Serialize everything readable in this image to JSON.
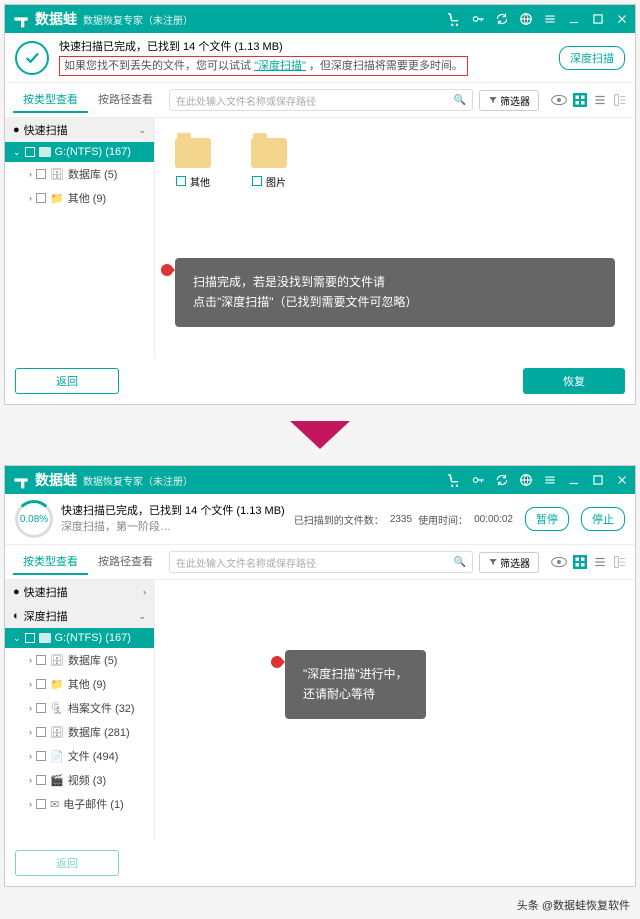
{
  "app": {
    "name": "数据蛙",
    "subtitle": "数据恢复专家（未注册）"
  },
  "win1": {
    "status_line1": "快速扫描已完成，已找到 14 个文件 (1.13 MB)",
    "hint_prefix": "如果您找不到丢失的文件，您可以试试",
    "hint_link": "\"深度扫描\"",
    "hint_suffix": "，但深度扫描将需要更多时间。",
    "deep_scan_btn": "深度扫描",
    "tabs": {
      "type": "按类型查看",
      "path": "按路径查看"
    },
    "search_placeholder": "在此处输入文件名称或保存路径",
    "filter_btn": "筛选器",
    "sidebar": {
      "quick": "快速扫描",
      "drive": "G:(NTFS) (167)",
      "children": [
        {
          "label": "数据库 (5)"
        },
        {
          "label": "其他 (9)"
        }
      ]
    },
    "files": [
      {
        "label": "其他"
      },
      {
        "label": "图片"
      }
    ],
    "tooltip_l1": "扫描完成，若是没找到需要的文件请",
    "tooltip_l2": "点击\"深度扫描\"（已找到需要文件可忽略）",
    "back_btn": "返回",
    "recover_btn": "恢复"
  },
  "win2": {
    "progress_pct": "0.08%",
    "status_line1": "快速扫描已完成，已找到 14 个文件 (1.13 MB)",
    "status_line2": "深度扫描，第一阶段…",
    "scanned_label": "已扫描到的文件数：",
    "scanned_count": "2335",
    "time_label": "使用时间：",
    "time_value": "00:00:02",
    "pause_btn": "暂停",
    "stop_btn": "停止",
    "tabs": {
      "type": "按类型查看",
      "path": "按路径查看"
    },
    "search_placeholder": "在此处输入文件名称或保存路径",
    "filter_btn": "筛选器",
    "sidebar": {
      "quick": "快速扫描",
      "deep": "深度扫描",
      "drive": "G:(NTFS) (167)",
      "children": [
        {
          "label": "数据库 (5)"
        },
        {
          "label": "其他 (9)"
        },
        {
          "label": "档案文件 (32)"
        },
        {
          "label": "数据库 (281)"
        },
        {
          "label": "文件 (494)"
        },
        {
          "label": "视频 (3)"
        },
        {
          "label": "电子邮件 (1)"
        }
      ]
    },
    "tooltip_l1": "\"深度扫描\"进行中，",
    "tooltip_l2": "还请耐心等待",
    "back_btn": "返回"
  },
  "attribution": "头条 @数据蛙恢复软件"
}
